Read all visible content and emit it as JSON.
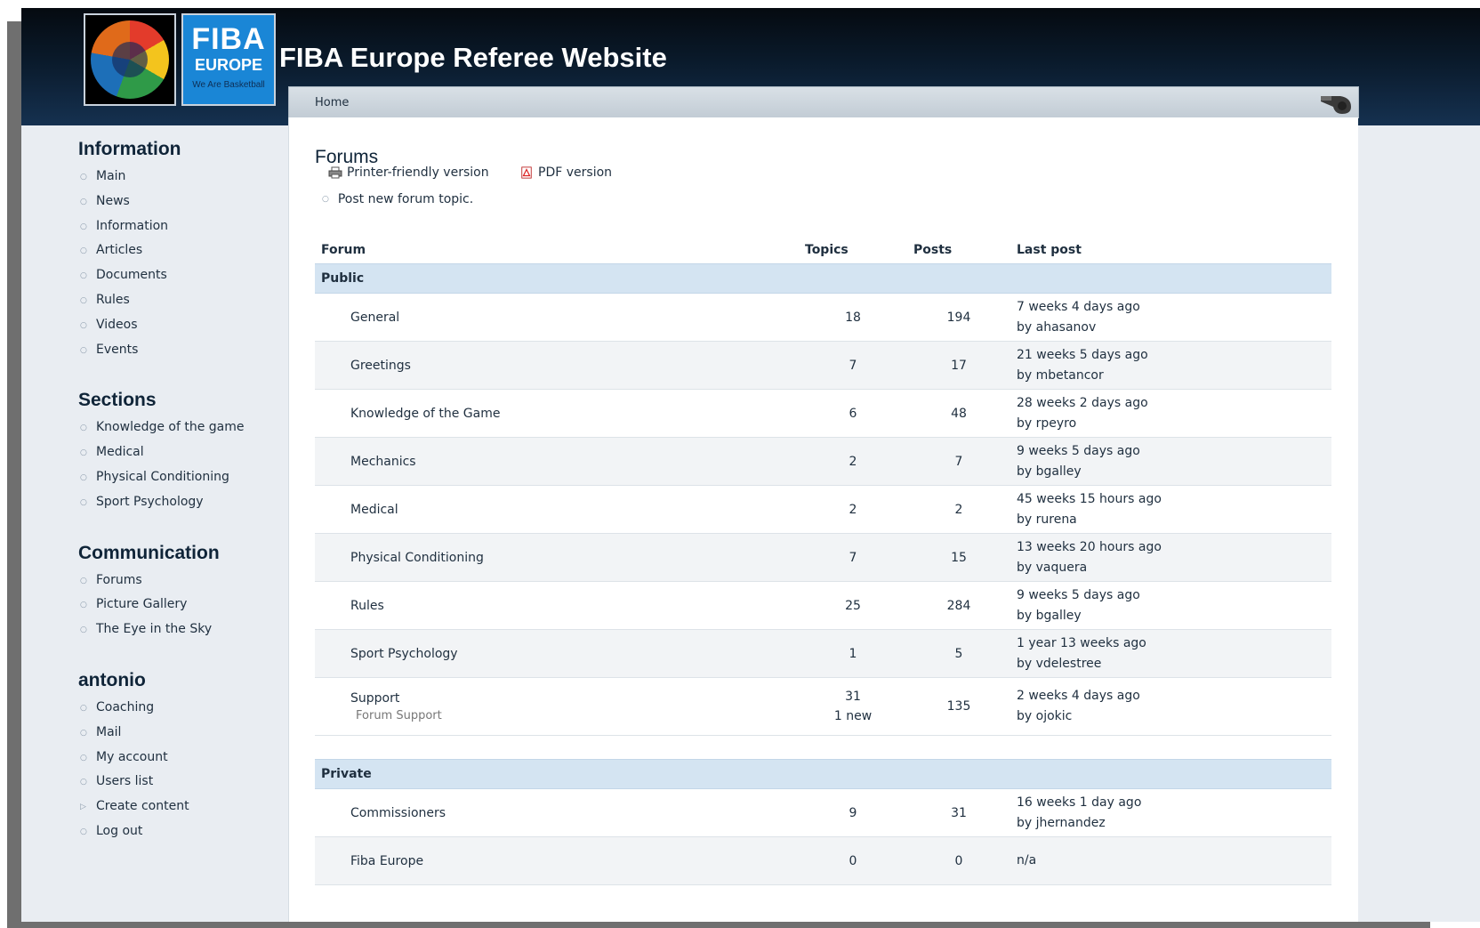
{
  "header": {
    "site_title": "FIBA Europe Referee Website",
    "logo": {
      "brand": "FIBA",
      "sub": "EUROPE",
      "tagline": "We Are Basketball"
    }
  },
  "breadcrumb": {
    "home": "Home"
  },
  "sidebar": {
    "blocks": [
      {
        "title": "Information",
        "items": [
          "Main",
          "News",
          "Information",
          "Articles",
          "Documents",
          "Rules",
          "Videos",
          "Events"
        ]
      },
      {
        "title": "Sections",
        "items": [
          "Knowledge of the game",
          "Medical",
          "Physical Conditioning",
          "Sport Psychology"
        ]
      },
      {
        "title": "Communication",
        "items": [
          "Forums",
          "Picture Gallery",
          "The Eye in the Sky"
        ]
      },
      {
        "title": "antonio",
        "items": [
          "Coaching",
          "Mail",
          "My account",
          "Users list",
          "Create content",
          "Log out"
        ]
      }
    ]
  },
  "main": {
    "title": "Forums",
    "printer_link": "Printer-friendly version",
    "pdf_link": "PDF version",
    "post_new": "Post new forum topic.",
    "columns": {
      "forum": "Forum",
      "topics": "Topics",
      "posts": "Posts",
      "last_post": "Last post"
    },
    "categories": [
      {
        "name": "Public",
        "forums": [
          {
            "name": "General",
            "topics": "18",
            "posts": "194",
            "last_time": "7 weeks 4 days ago",
            "last_by": "by ahasanov"
          },
          {
            "name": "Greetings",
            "topics": "7",
            "posts": "17",
            "last_time": "21 weeks 5 days ago",
            "last_by": "by mbetancor"
          },
          {
            "name": "Knowledge of the Game",
            "topics": "6",
            "posts": "48",
            "last_time": "28 weeks 2 days ago",
            "last_by": "by rpeyro"
          },
          {
            "name": "Mechanics",
            "topics": "2",
            "posts": "7",
            "last_time": "9 weeks 5 days ago",
            "last_by": "by bgalley"
          },
          {
            "name": "Medical",
            "topics": "2",
            "posts": "2",
            "last_time": "45 weeks 15 hours ago",
            "last_by": "by rurena"
          },
          {
            "name": "Physical Conditioning",
            "topics": "7",
            "posts": "15",
            "last_time": "13 weeks 20 hours ago",
            "last_by": "by vaquera"
          },
          {
            "name": "Rules",
            "topics": "25",
            "posts": "284",
            "last_time": "9 weeks 5 days ago",
            "last_by": "by bgalley"
          },
          {
            "name": "Sport Psychology",
            "topics": "1",
            "posts": "5",
            "last_time": "1 year 13 weeks ago",
            "last_by": "by vdelestree"
          },
          {
            "name": "Support",
            "description": "Forum Support",
            "topics": "31",
            "new_topics": "1 new",
            "posts": "135",
            "last_time": "2 weeks 4 days ago",
            "last_by": "by ojokic"
          }
        ]
      },
      {
        "name": "Private",
        "forums": [
          {
            "name": "Commissioners",
            "topics": "9",
            "posts": "31",
            "last_time": "16 weeks 1 day ago",
            "last_by": "by jhernandez"
          },
          {
            "name": "Fiba Europe",
            "topics": "0",
            "posts": "0",
            "last_time": "n/a",
            "last_by": ""
          }
        ]
      }
    ]
  }
}
